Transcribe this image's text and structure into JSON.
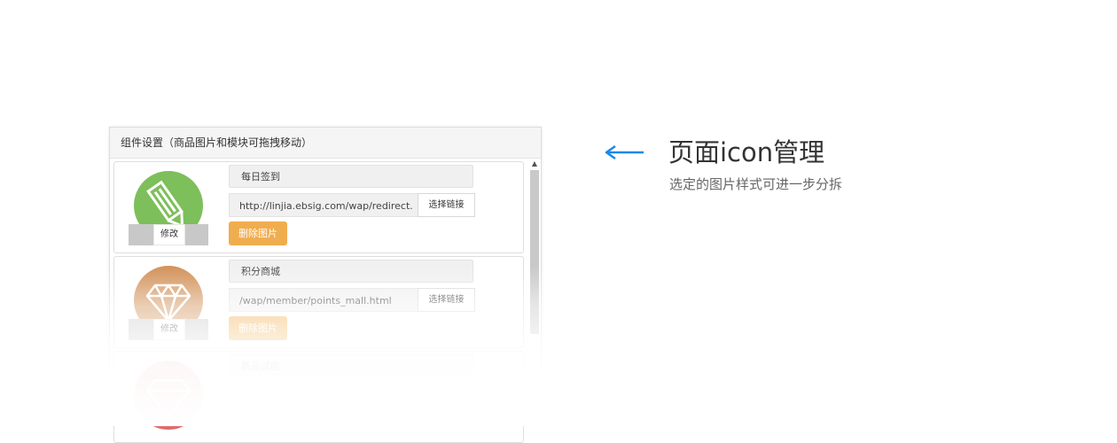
{
  "panel": {
    "title": "组件设置（商品图片和模块可拖拽移动）",
    "items": [
      {
        "name": "每日签到",
        "link": "http://linjia.ebsig.com/wap/redirect.",
        "link_button": "选择链接",
        "delete_button": "删除图片",
        "edit_button": "修改",
        "icon": "pencil-icon",
        "icon_color": "#7dbf5a"
      },
      {
        "name": "积分商城",
        "link": "/wap/member/points_mall.html",
        "link_button": "选择链接",
        "delete_button": "删除图片",
        "edit_button": "修改",
        "icon": "diamond-icon",
        "icon_color": "#d2925a"
      },
      {
        "name": "新品试吃",
        "icon": "diamond-icon",
        "icon_color": "#e06a6a"
      }
    ]
  },
  "scroll_up_glyph": "▲",
  "feature": {
    "arrow": "left-arrow-icon",
    "arrow_color": "#1e88e5",
    "title": "页面icon管理",
    "subtitle": "选定的图片样式可进一步分拆"
  }
}
